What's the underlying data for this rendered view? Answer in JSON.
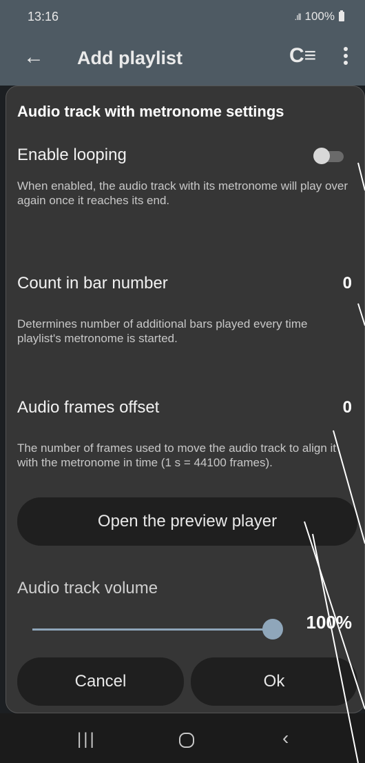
{
  "status_bar": {
    "time": "13:16",
    "signal": ".ıll",
    "battery": "100%"
  },
  "app_bar": {
    "title": "Add playlist",
    "back_icon": "arrow-back-icon",
    "reload_icon": "reload-list-icon",
    "more_icon": "more-vert-icon"
  },
  "dialog": {
    "title": "Audio track with metronome settings",
    "looping": {
      "label": "Enable looping",
      "description": "When enabled, the audio track with its metronome will play over again once it reaches its end.",
      "enabled": false
    },
    "count_in": {
      "label": "Count in bar number",
      "value": "0",
      "description": "Determines number of additional bars played every time playlist's metronome is started."
    },
    "frames_offset": {
      "label": "Audio frames offset",
      "value": "0",
      "description": "The number of frames used to move the audio track to align it with the metronome in time (1 s = 44100 frames)."
    },
    "preview_button": "Open the preview player",
    "volume": {
      "label": "Audio track volume",
      "value_text": "100%",
      "level": 1.0
    },
    "cancel_button": "Cancel",
    "ok_button": "Ok"
  },
  "nav_bar": {
    "recents_icon": "recents-icon",
    "home_icon": "home-icon",
    "back_icon": "back-chevron-icon"
  },
  "colors": {
    "appbar": "#4e5a63",
    "dialog": "#363636",
    "accent": "#8fa6ba",
    "button": "#1f1f1f"
  }
}
